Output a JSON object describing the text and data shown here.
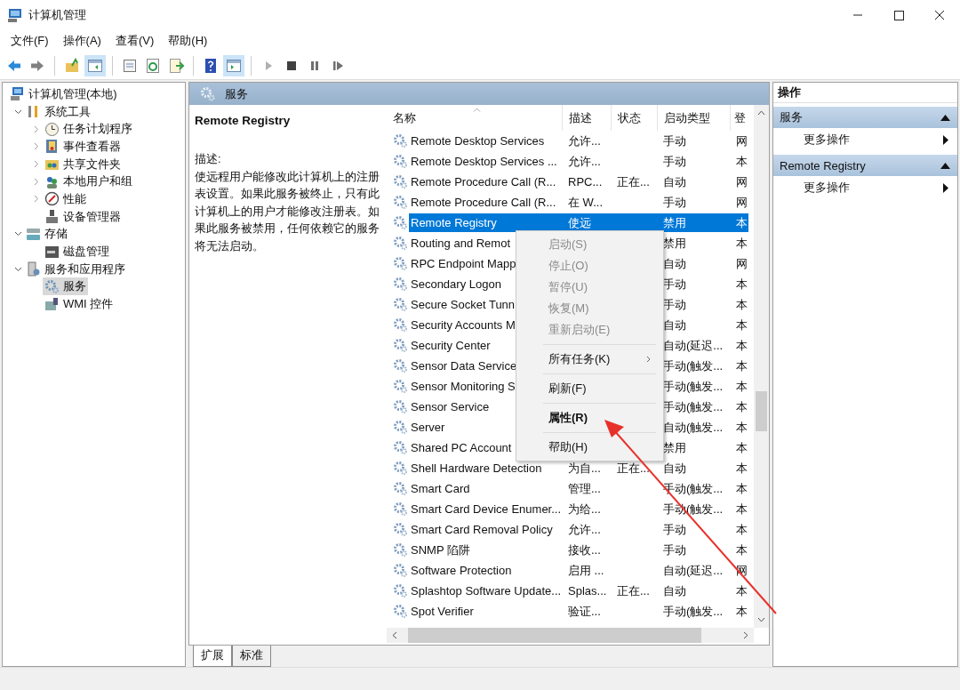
{
  "window": {
    "title": "计算机管理"
  },
  "menu": [
    "文件(F)",
    "操作(A)",
    "查看(V)",
    "帮助(H)"
  ],
  "toolbar": [
    [
      {
        "pressed": false,
        "disabled": false
      },
      {
        "pressed": false,
        "disabled": false
      }
    ],
    [
      {
        "pressed": false,
        "disabled": false
      },
      {
        "pressed": true,
        "disabled": false
      }
    ],
    [
      {
        "pressed": false,
        "disabled": false
      },
      {
        "pressed": false,
        "disabled": false
      },
      {
        "pressed": false,
        "disabled": false
      }
    ],
    [
      {
        "pressed": false,
        "disabled": false
      },
      {
        "pressed": true,
        "disabled": false
      }
    ],
    [
      {
        "pressed": false,
        "disabled": true
      },
      {
        "pressed": false,
        "disabled": false
      },
      {
        "pressed": false,
        "disabled": false
      },
      {
        "pressed": false,
        "disabled": false
      }
    ]
  ],
  "tree": [
    {
      "label": "计算机管理(本地)",
      "selected": false,
      "children": [
        {
          "label": "系统工具",
          "expanded": true,
          "selected": false,
          "children": [
            {
              "label": "任务计划程序",
              "expanded": false,
              "selected": false
            },
            {
              "label": "事件查看器",
              "expanded": false,
              "selected": false
            },
            {
              "label": "共享文件夹",
              "expanded": false,
              "selected": false
            },
            {
              "label": "本地用户和组",
              "expanded": false,
              "selected": false
            },
            {
              "label": "性能",
              "expanded": false,
              "selected": false
            },
            {
              "label": "设备管理器",
              "selected": false
            }
          ]
        },
        {
          "label": "存储",
          "expanded": true,
          "selected": false,
          "children": [
            {
              "label": "磁盘管理",
              "selected": false
            }
          ]
        },
        {
          "label": "服务和应用程序",
          "expanded": true,
          "selected": false,
          "children": [
            {
              "label": "服务",
              "selected": true
            },
            {
              "label": "WMI 控件",
              "selected": false
            }
          ]
        }
      ]
    }
  ],
  "panel_header": "服务",
  "description": {
    "title": "Remote Registry",
    "label": "描述:",
    "text": "使远程用户能修改此计算机上的注册表设置。如果此服务被终止，只有此计算机上的用户才能修改注册表。如果此服务被禁用，任何依赖它的服务将无法启动。"
  },
  "table": {
    "columns": [
      "名称",
      "描述",
      "状态",
      "启动类型",
      "登"
    ],
    "rows": [
      {
        "name": "Remote Desktop Services",
        "description": "允许...",
        "startup": "手动",
        "logon": "网",
        "selected": false
      },
      {
        "name": "Remote Desktop Services ...",
        "description": "允许...",
        "startup": "手动",
        "logon": "本",
        "selected": false
      },
      {
        "name": "Remote Procedure Call (R...",
        "description": "RPC...",
        "status": "正在...",
        "startup": "自动",
        "logon": "网",
        "selected": false
      },
      {
        "name": "Remote Procedure Call (R...",
        "description": "在 W...",
        "startup": "手动",
        "logon": "网",
        "selected": false
      },
      {
        "name": "Remote Registry",
        "description": "使远",
        "startup": "禁用",
        "logon": "本",
        "selected": true
      },
      {
        "name": "Routing and Remot",
        "startup": "禁用",
        "logon": "本",
        "selected": false
      },
      {
        "name": "RPC Endpoint Mapp",
        "startup": "自动",
        "logon": "网",
        "selected": false
      },
      {
        "name": "Secondary Logon",
        "startup": "手动",
        "logon": "本",
        "selected": false
      },
      {
        "name": "Secure Socket Tunn",
        "startup": "手动",
        "logon": "本",
        "selected": false
      },
      {
        "name": "Security Accounts M",
        "startup": "自动",
        "logon": "本",
        "selected": false
      },
      {
        "name": "Security Center",
        "startup": "自动(延迟...",
        "logon": "本",
        "selected": false
      },
      {
        "name": "Sensor Data Service",
        "startup": "手动(触发...",
        "logon": "本",
        "selected": false
      },
      {
        "name": "Sensor Monitoring S",
        "startup": "手动(触发...",
        "logon": "本",
        "selected": false
      },
      {
        "name": "Sensor Service",
        "startup": "手动(触发...",
        "logon": "本",
        "selected": false
      },
      {
        "name": "Server",
        "startup": "自动(触发...",
        "logon": "本",
        "selected": false
      },
      {
        "name": "Shared PC Account",
        "startup": "禁用",
        "logon": "本",
        "selected": false
      },
      {
        "name": "Shell Hardware Detection",
        "description": "为自...",
        "status": "正在...",
        "startup": "自动",
        "logon": "本",
        "selected": false
      },
      {
        "name": "Smart Card",
        "description": "管理...",
        "startup": "手动(触发...",
        "logon": "本",
        "selected": false
      },
      {
        "name": "Smart Card Device Enumer...",
        "description": "为给...",
        "startup": "手动(触发...",
        "logon": "本",
        "selected": false
      },
      {
        "name": "Smart Card Removal Policy",
        "description": "允许...",
        "startup": "手动",
        "logon": "本",
        "selected": false
      },
      {
        "name": "SNMP 陷阱",
        "description": "接收...",
        "startup": "手动",
        "logon": "本",
        "selected": false
      },
      {
        "name": "Software Protection",
        "description": "启用 ...",
        "startup": "自动(延迟...",
        "logon": "网",
        "selected": false
      },
      {
        "name": "Splashtop Software Update...",
        "description": "Splas...",
        "status": "正在...",
        "startup": "自动",
        "logon": "本",
        "selected": false
      },
      {
        "name": "Spot Verifier",
        "description": "验证...",
        "startup": "手动(触发...",
        "logon": "本",
        "selected": false
      }
    ]
  },
  "context_menu": [
    {
      "kind": "item",
      "label": "启动(S)",
      "disabled": true,
      "bold": false,
      "submenu": false
    },
    {
      "kind": "item",
      "label": "停止(O)",
      "disabled": true,
      "bold": false,
      "submenu": false
    },
    {
      "kind": "item",
      "label": "暂停(U)",
      "disabled": true,
      "bold": false,
      "submenu": false
    },
    {
      "kind": "item",
      "label": "恢复(M)",
      "disabled": true,
      "bold": false,
      "submenu": false
    },
    {
      "kind": "item",
      "label": "重新启动(E)",
      "disabled": true,
      "bold": false,
      "submenu": false
    },
    {
      "kind": "separator"
    },
    {
      "kind": "item",
      "label": "所有任务(K)",
      "disabled": false,
      "bold": false,
      "submenu": true
    },
    {
      "kind": "separator"
    },
    {
      "kind": "item",
      "label": "刷新(F)",
      "disabled": false,
      "bold": false,
      "submenu": false
    },
    {
      "kind": "separator"
    },
    {
      "kind": "item",
      "label": "属性(R)",
      "disabled": false,
      "bold": true,
      "submenu": false
    },
    {
      "kind": "separator"
    },
    {
      "kind": "item",
      "label": "帮助(H)",
      "disabled": false,
      "bold": false,
      "submenu": false
    }
  ],
  "tabs": [
    {
      "label": "扩展",
      "selected": true
    },
    {
      "label": "标准",
      "selected": false
    }
  ],
  "actions": {
    "title": "操作",
    "sections": [
      {
        "title": "服务",
        "expanded": true,
        "items": [
          "更多操作"
        ]
      },
      {
        "title": "Remote Registry",
        "expanded": true,
        "items": [
          "更多操作"
        ]
      }
    ]
  }
}
